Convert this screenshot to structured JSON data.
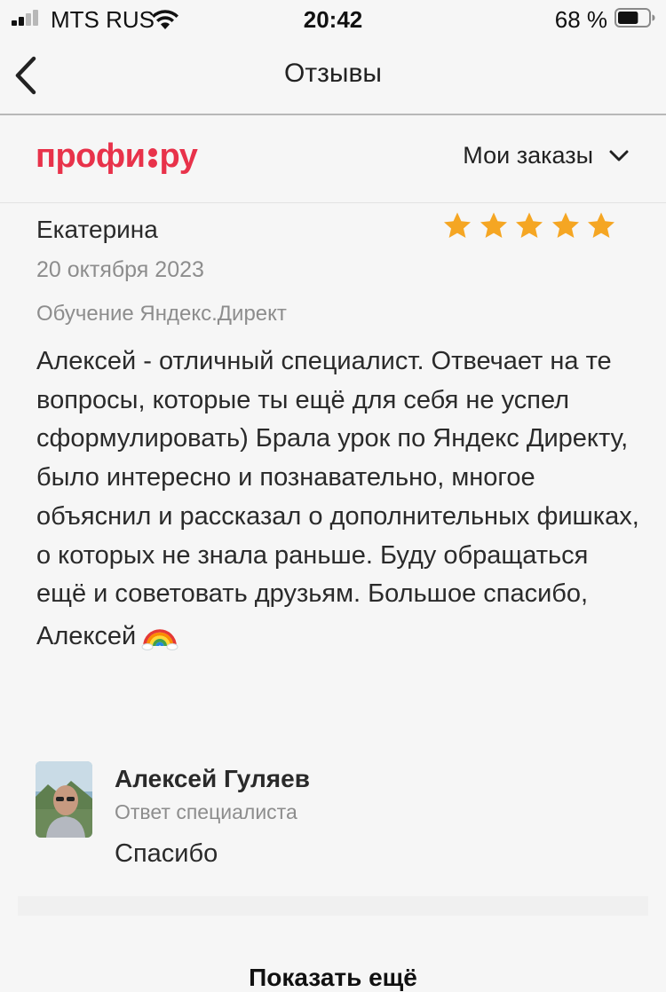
{
  "status_bar": {
    "carrier": "MTS RUS",
    "time": "20:42",
    "battery_percent": "68 %",
    "battery_level": 0.68
  },
  "nav": {
    "title": "Отзывы"
  },
  "site_header": {
    "logo": "профи.ру",
    "logo_left": "профи",
    "logo_right": "ру",
    "orders_label": "Мои заказы",
    "brand_color": "#e8324a"
  },
  "review": {
    "author": "Екатерина",
    "date": "20 октября 2023",
    "service": "Обучение Яндекс.Директ",
    "rating": 5,
    "star_color": "#f5a623",
    "text": "Алексей - отличный специалист. Отвечает на те вопросы, которые ты ещё для себя не успел сформулировать) Брала урок по Яндекс Директу, было интересно и познавательно, многое объяснил и рассказал о дополнительных фишках, о которых не знала раньше. Буду обращаться ещё и советовать друзьям. Большое спасибо, Алексей",
    "emoji": "rainbow-emoji"
  },
  "reply": {
    "author": "Алексей Гуляев",
    "role": "Ответ специалиста",
    "text": "Спасибо"
  },
  "show_more_label": "Показать ещё"
}
